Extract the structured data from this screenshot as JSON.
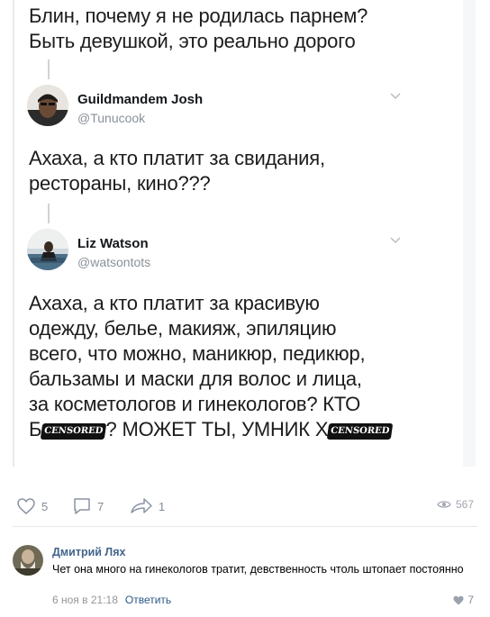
{
  "tweet_card": {
    "intro_lines": [
      "Блин, почему я не родилась парнем?",
      "Быть девушкой, это реально дорого"
    ],
    "reply1": {
      "name": "Guildmandem Josh",
      "handle": "@Tunucook",
      "lines": [
        "Ахаха, а кто платит за свидания,",
        "рестораны, кино???"
      ]
    },
    "reply2": {
      "name": "Liz Watson",
      "handle": "@watsontots",
      "lines": [
        "Ахаха, а кто платит за красивую",
        "одежду, белье, макияж, эпиляцию",
        "всего, что можно, маникюр, педикюр,",
        "бальзамы и маски для волос и лица,",
        "за косметологов и гинекологов? КТО"
      ],
      "last_line": {
        "part1": "Б",
        "censor1": "CENSORED",
        "part2": "? МОЖЕТ ТЫ, УМНИК Х",
        "censor2": "CENSORED"
      }
    }
  },
  "post_actions": {
    "likes": "5",
    "comments": "7",
    "shares": "1",
    "views": "567"
  },
  "comment": {
    "author": "Дмитрий Лях",
    "text": "Чет она много на гинекологов тратит, девственность чтоль штопает постоянно",
    "date": "6 ноя в 21:18",
    "reply_label": "Ответить",
    "likes": "7"
  },
  "colors": {
    "link": "#42648b",
    "muted": "#828a99",
    "text": "#1c1c1c"
  },
  "icons": [
    "heart-icon",
    "comment-icon",
    "share-icon",
    "eye-icon",
    "chevron-down-icon"
  ]
}
